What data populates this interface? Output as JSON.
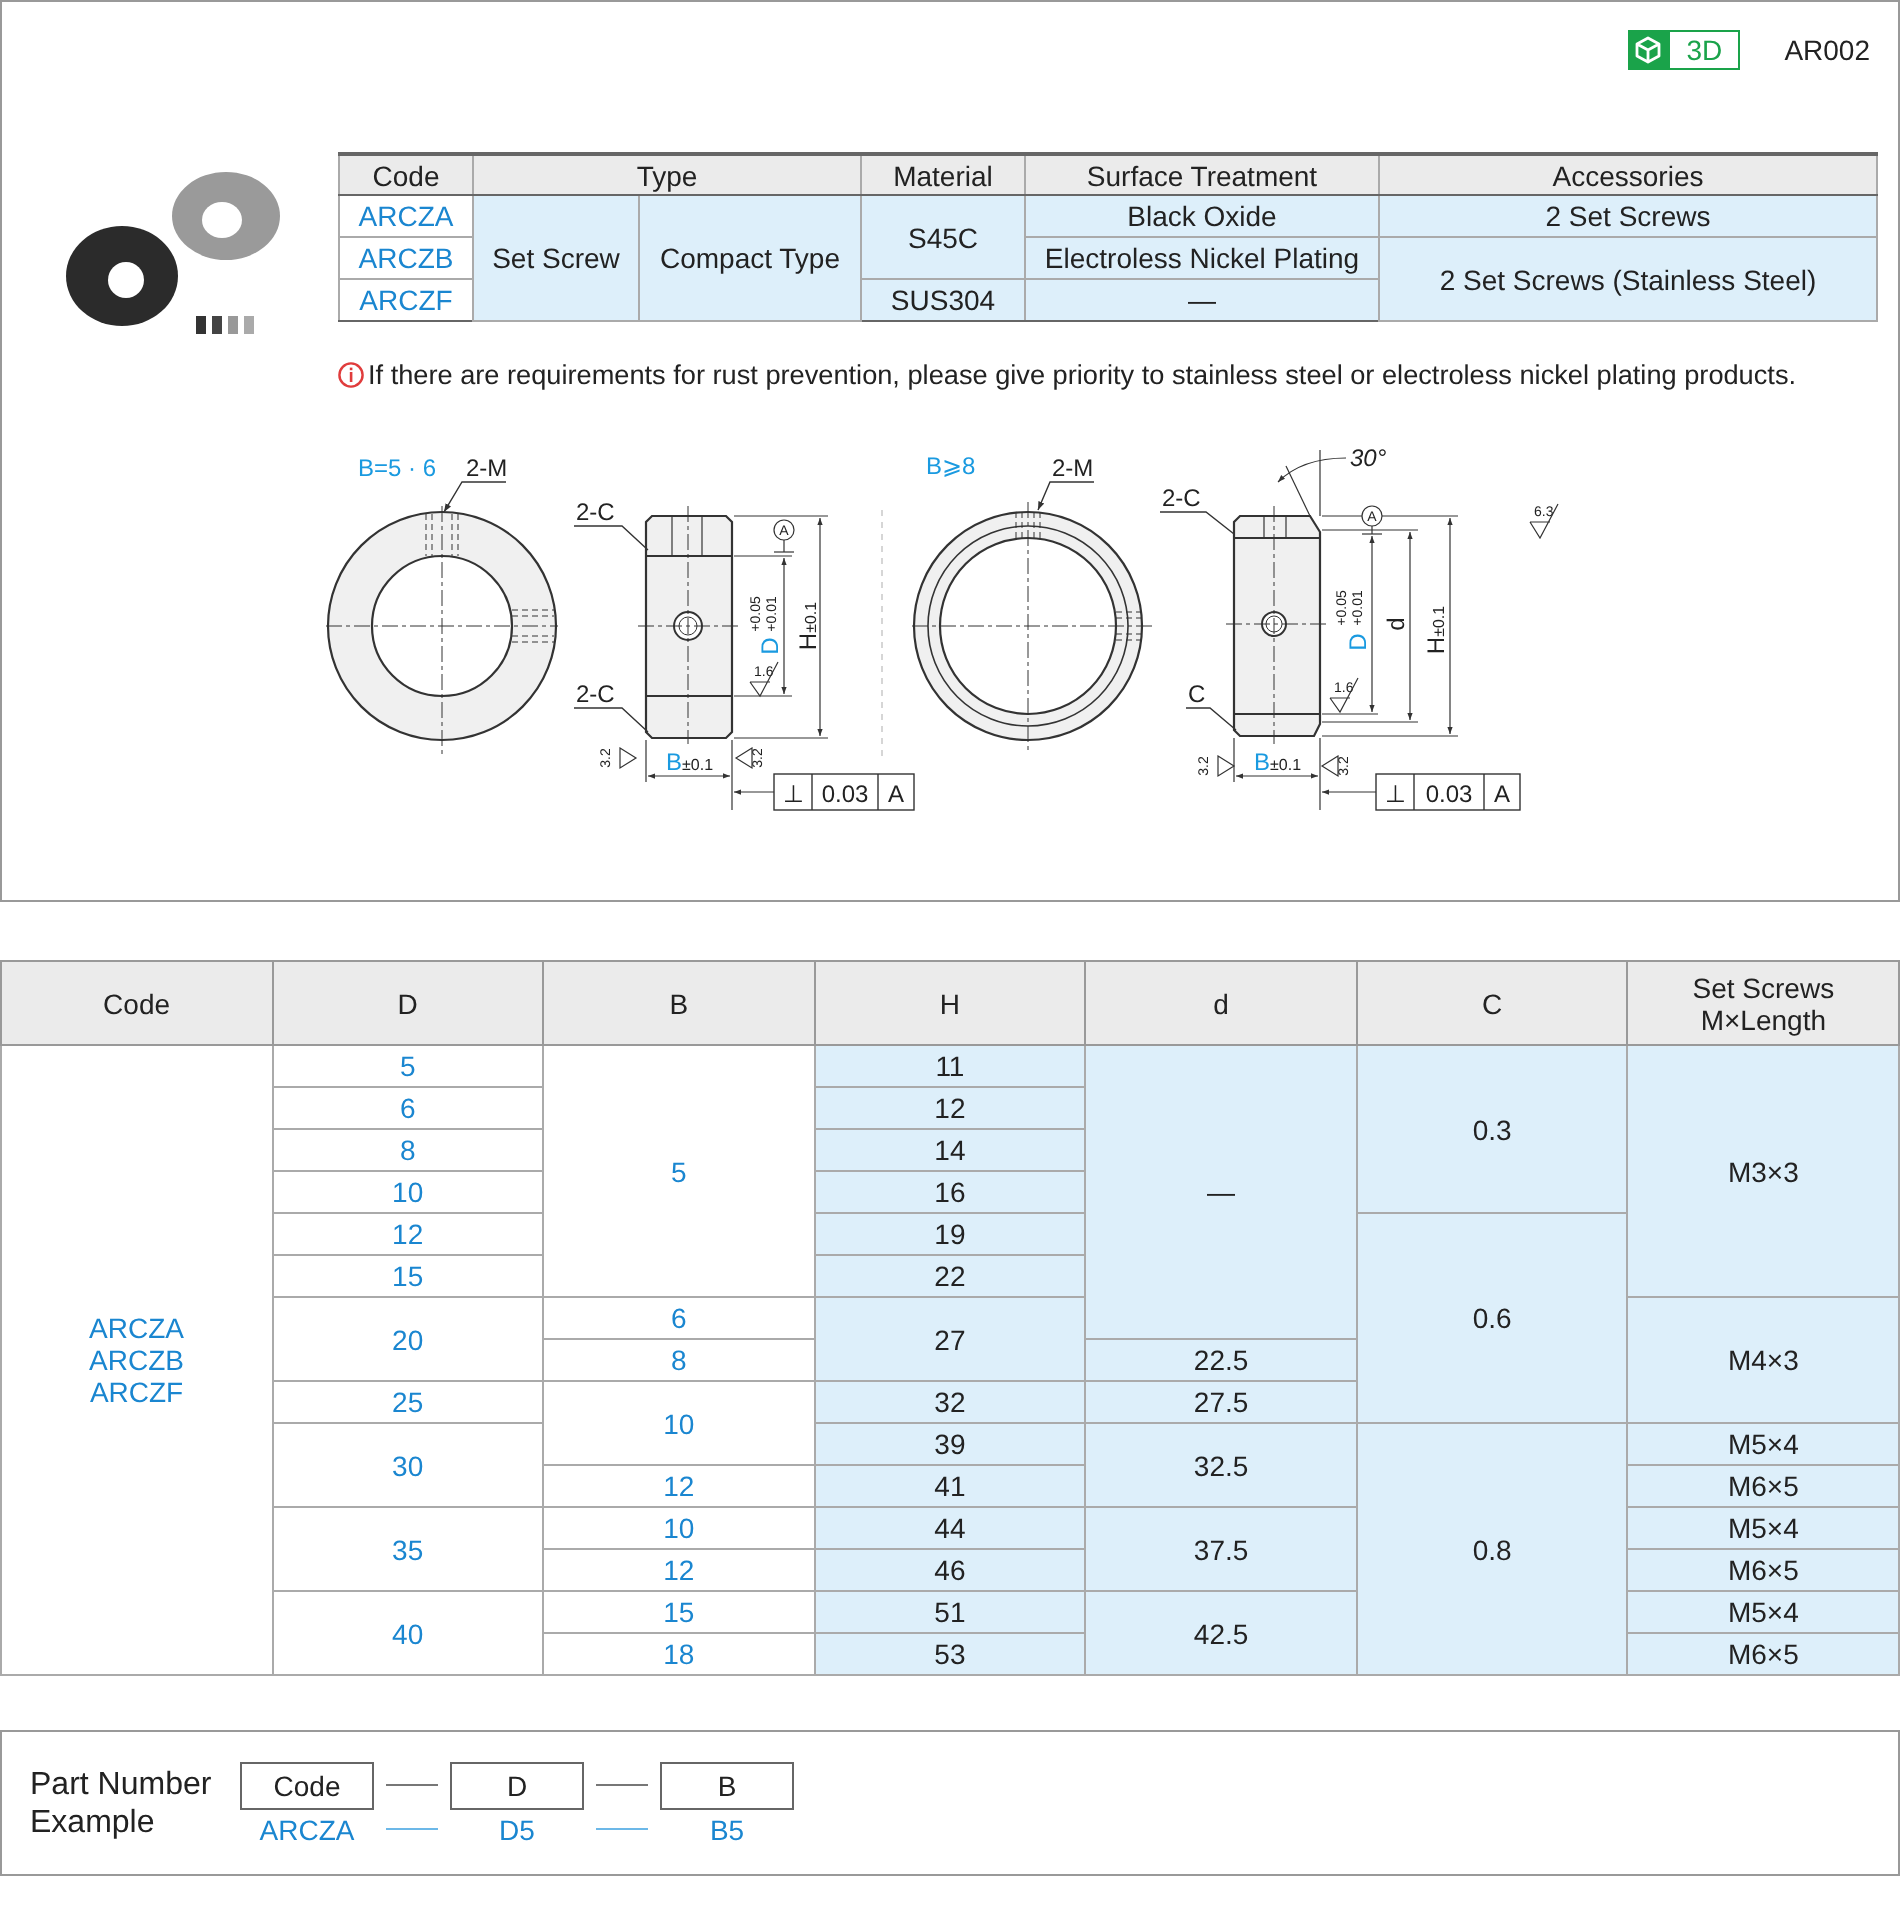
{
  "header": {
    "badge": "3D",
    "code": "AR002"
  },
  "product_table": {
    "columns": [
      {
        "text": "Code"
      },
      {
        "text": "Type",
        "colspan": 2
      },
      {
        "text": "Material"
      },
      {
        "text": "Surface Treatment"
      },
      {
        "text": "Accessories"
      }
    ],
    "rows": [
      [
        {
          "text": "ARCZA",
          "kind": "key"
        },
        {
          "text": "Set Screw",
          "kind": "value",
          "rowspan": 3
        },
        {
          "text": "Compact Type",
          "kind": "value",
          "rowspan": 3
        },
        {
          "text": "S45C",
          "kind": "value",
          "rowspan": 2
        },
        {
          "text": "Black Oxide",
          "kind": "value"
        },
        {
          "text": "2 Set Screws",
          "kind": "value"
        }
      ],
      [
        {
          "text": "ARCZB",
          "kind": "key"
        },
        {
          "text": "Electroless Nickel Plating",
          "kind": "value"
        },
        {
          "text": "2 Set Screws (Stainless Steel)",
          "kind": "value",
          "rowspan": 2
        }
      ],
      [
        {
          "text": "ARCZF",
          "kind": "key"
        },
        {
          "text": "SUS304",
          "kind": "value"
        },
        {
          "text": "—",
          "kind": "value"
        }
      ]
    ]
  },
  "note": "If there are requirements for rust prevention, please give priority to stainless steel or electroless nickel plating products.",
  "drawings": [
    {
      "title": "B=5 · 6",
      "hole_callout": "2-M",
      "chamfer_callouts": [
        "2-C",
        "2-C"
      ],
      "datum": "A",
      "bore_symbol": "D",
      "bore_tolerance": [
        "+0.05",
        "+0.01"
      ],
      "height_symbol": "H",
      "height_tolerance": "±0.1",
      "roughness_marks": [
        "1.6",
        "3.2",
        "3.2"
      ],
      "width_symbol": "B",
      "width_tolerance": "±0.1",
      "perpendicularity": {
        "symbol": "⊥",
        "value": "0.03",
        "datum": "A"
      }
    },
    {
      "title": "B⩾8",
      "hole_callout": "2-M",
      "chamfer_callouts": [
        "2-C",
        "C"
      ],
      "angle": "30°",
      "datum": "A",
      "bore_symbol": "D",
      "bore_tolerance": [
        "+0.05",
        "+0.01"
      ],
      "step_symbol": "d",
      "height_symbol": "H",
      "height_tolerance": "±0.1",
      "roughness_marks": [
        "1.6",
        "3.2",
        "3.2"
      ],
      "width_symbol": "B",
      "width_tolerance": "±0.1",
      "perpendicularity": {
        "symbol": "⊥",
        "value": "0.03",
        "datum": "A"
      },
      "general_roughness": "6.3"
    }
  ],
  "spec_table": {
    "columns": [
      "Code",
      "D",
      "B",
      "H",
      "d",
      "C",
      "Set Screws\nM×Length"
    ],
    "rows": [
      [
        {
          "text": "ARCZA\nARCZB\nARCZF",
          "kind": "key",
          "rowspan": 16
        },
        {
          "text": "5",
          "kind": "key"
        },
        {
          "text": "5",
          "kind": "key",
          "rowspan": 6
        },
        {
          "text": "11",
          "kind": "value"
        },
        {
          "text": "—",
          "kind": "value",
          "rowspan": 7
        },
        {
          "text": "0.3",
          "kind": "value",
          "rowspan": 4
        },
        {
          "text": "M3×3",
          "kind": "value",
          "rowspan": 6
        }
      ],
      [
        {
          "text": "6",
          "kind": "key"
        },
        {
          "text": "12",
          "kind": "value"
        }
      ],
      [
        {
          "text": "8",
          "kind": "key"
        },
        {
          "text": "14",
          "kind": "value"
        }
      ],
      [
        {
          "text": "10",
          "kind": "key"
        },
        {
          "text": "16",
          "kind": "value"
        }
      ],
      [
        {
          "text": "12",
          "kind": "key"
        },
        {
          "text": "19",
          "kind": "value"
        },
        {
          "text": "0.6",
          "kind": "value",
          "rowspan": 6
        }
      ],
      [
        {
          "text": "15",
          "kind": "key"
        },
        {
          "text": "22",
          "kind": "value"
        }
      ],
      [
        {
          "text": "20",
          "kind": "key",
          "rowspan": 2
        },
        {
          "text": "6",
          "kind": "key"
        },
        {
          "text": "27",
          "kind": "value",
          "rowspan": 2
        },
        {
          "text": "M4×3",
          "kind": "value",
          "rowspan": 4
        }
      ],
      [
        {
          "text": "8",
          "kind": "key",
          "rowspan": 2
        },
        {
          "text": "22.5",
          "kind": "value"
        }
      ],
      [
        {
          "text": "25",
          "kind": "key",
          "rowspan": 2
        },
        {
          "text": "32",
          "kind": "value",
          "rowspan": 2
        },
        {
          "text": "27.5",
          "kind": "value",
          "rowspan": 2
        }
      ],
      [
        {
          "text": "10",
          "kind": "key",
          "rowspan": 2
        }
      ],
      [
        {
          "text": "30",
          "kind": "key",
          "rowspan": 2
        },
        {
          "text": "39",
          "kind": "value"
        },
        {
          "text": "32.5",
          "kind": "value",
          "rowspan": 2
        },
        {
          "text": "0.8",
          "kind": "value",
          "rowspan": 6
        },
        {
          "text": "M5×4",
          "kind": "value"
        }
      ],
      [
        {
          "text": "12",
          "kind": "key"
        },
        {
          "text": "41",
          "kind": "value"
        },
        {
          "text": "M6×5",
          "kind": "value"
        }
      ],
      [
        {
          "text": "35",
          "kind": "key",
          "rowspan": 2
        },
        {
          "text": "10",
          "kind": "key"
        },
        {
          "text": "44",
          "kind": "value"
        },
        {
          "text": "37.5",
          "kind": "value",
          "rowspan": 2
        },
        {
          "text": "M5×4",
          "kind": "value"
        }
      ],
      [
        {
          "text": "12",
          "kind": "key"
        },
        {
          "text": "46",
          "kind": "value"
        },
        {
          "text": "M6×5",
          "kind": "value"
        }
      ],
      [
        {
          "text": "40",
          "kind": "key",
          "rowspan": 2
        },
        {
          "text": "15",
          "kind": "key"
        },
        {
          "text": "51",
          "kind": "value"
        },
        {
          "text": "42.5",
          "kind": "value",
          "rowspan": 2
        },
        {
          "text": "M5×4",
          "kind": "value"
        }
      ],
      [
        {
          "text": "18",
          "kind": "key"
        },
        {
          "text": "53",
          "kind": "value"
        },
        {
          "text": "M6×5",
          "kind": "value"
        }
      ]
    ]
  },
  "part_number_example": {
    "label": "Part Number Example",
    "fields": [
      {
        "name": "Code",
        "example": "ARCZA"
      },
      {
        "name": "D",
        "example": "D5"
      },
      {
        "name": "B",
        "example": "B5"
      }
    ]
  }
}
